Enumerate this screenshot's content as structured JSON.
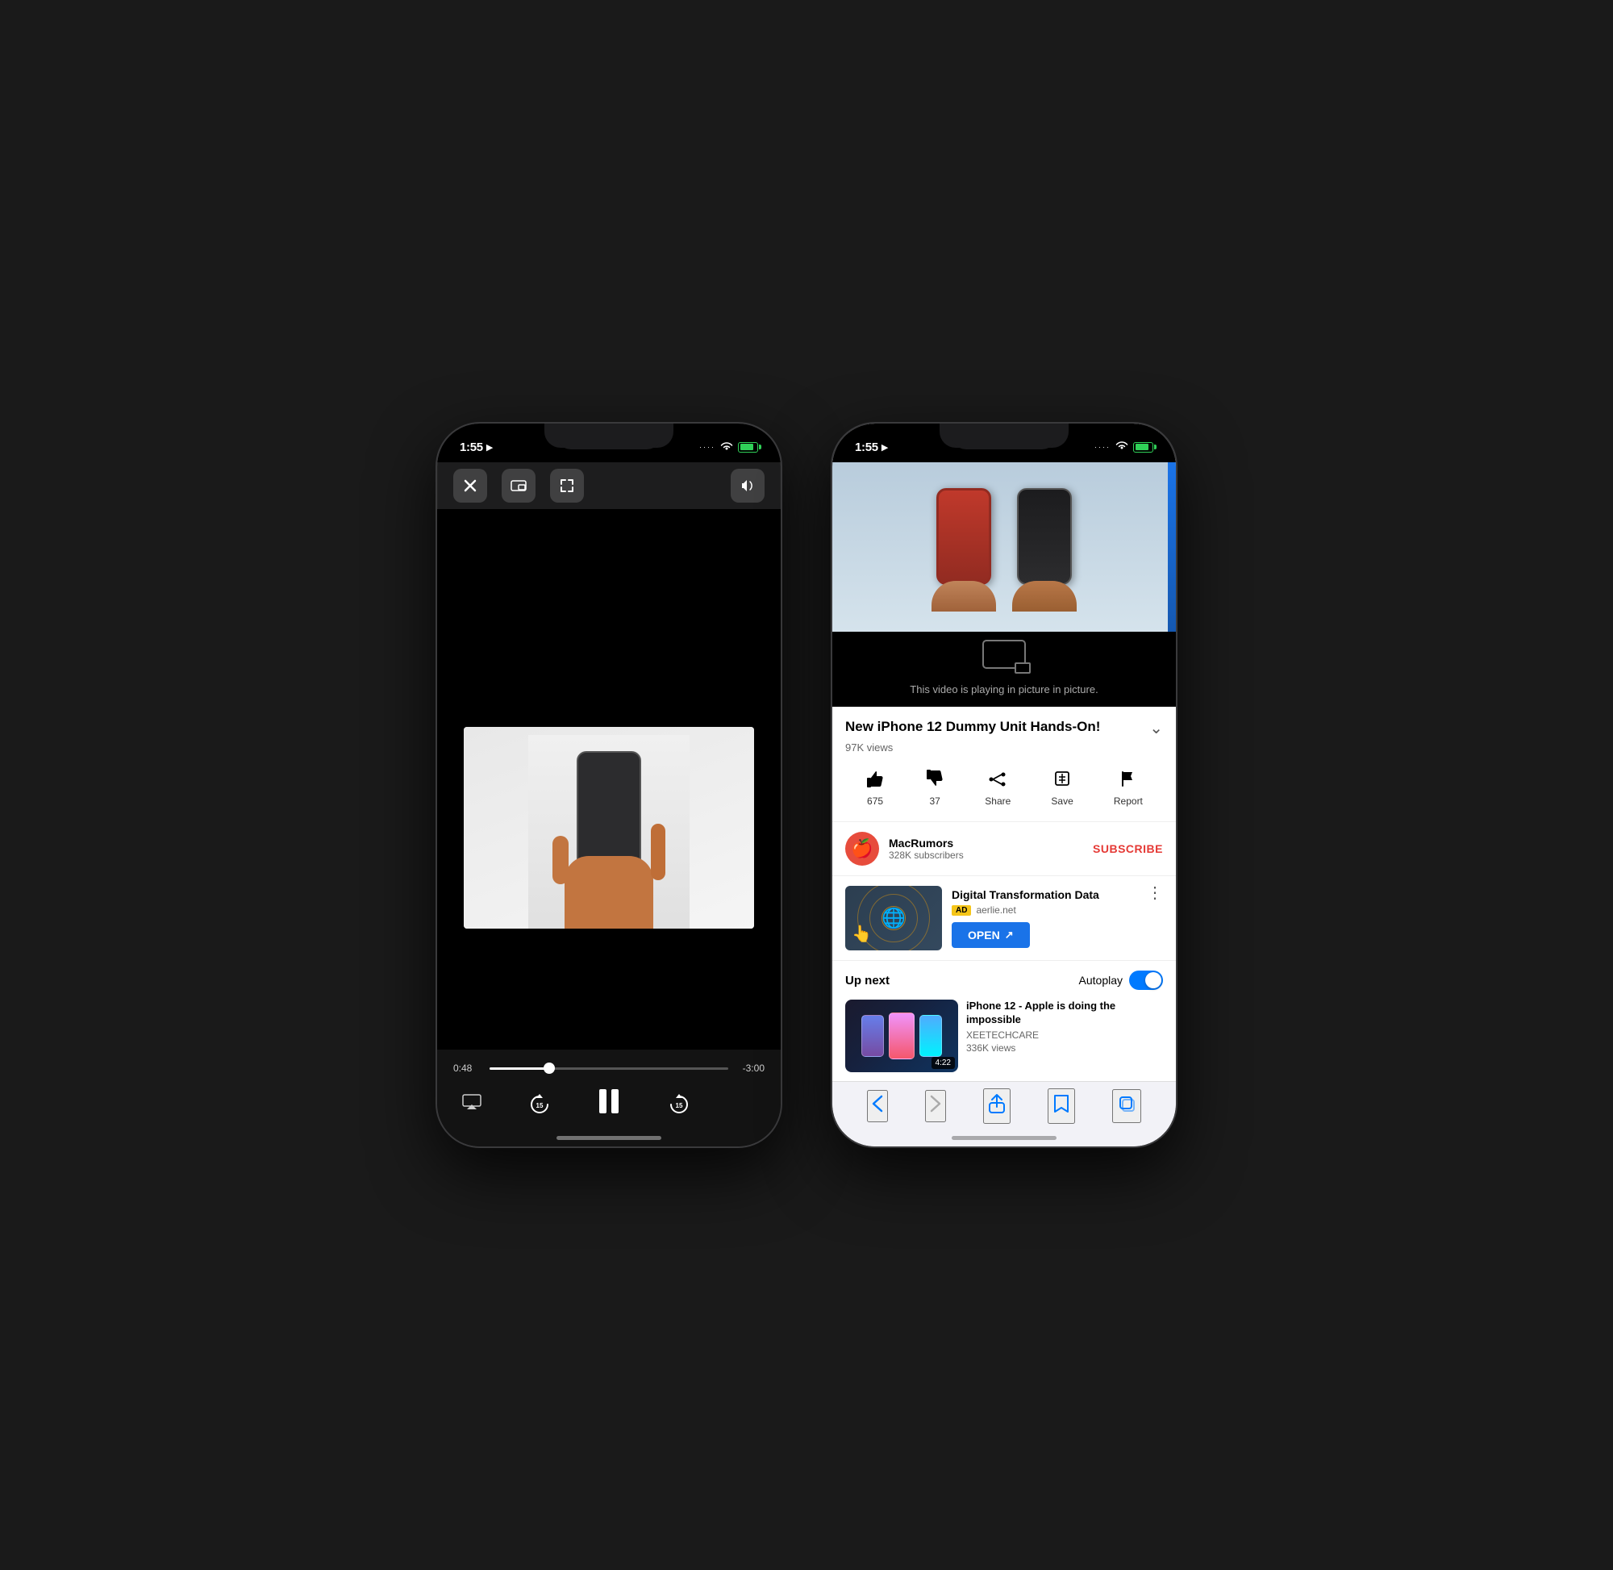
{
  "left_phone": {
    "status": {
      "time": "1:55",
      "location_icon": "▶",
      "signal_dots": "····",
      "wifi": "wifi",
      "battery_percent": 80
    },
    "player": {
      "close_label": "×",
      "pip_label": "⊡",
      "expand_label": "⤢",
      "volume_label": "🔈",
      "time_current": "0:48",
      "time_remaining": "-3:00",
      "skip_back_seconds": "15",
      "skip_fwd_seconds": "15",
      "progress_percent": 25
    }
  },
  "right_phone": {
    "status": {
      "time": "1:55",
      "location_icon": "▶"
    },
    "pip": {
      "caption": "This video is playing in picture in picture."
    },
    "video": {
      "title": "New iPhone 12 Dummy Unit Hands-On!",
      "views": "97K views",
      "likes": "675",
      "dislikes": "37",
      "share_label": "Share",
      "save_label": "Save",
      "report_label": "Report"
    },
    "channel": {
      "name": "MacRumors",
      "subscribers": "328K subscribers",
      "subscribe_label": "SUBSCRIBE",
      "avatar_emoji": "🍎"
    },
    "ad": {
      "title": "Digital Transformation Data",
      "badge": "AD",
      "domain": "aerlie.net",
      "open_label": "OPEN",
      "open_icon": "↗"
    },
    "up_next": {
      "label": "Up next",
      "autoplay_label": "Autoplay",
      "autoplay_on": true,
      "video": {
        "title": "iPhone 12 - Apple is doing the impossible",
        "channel": "XEETECHCARE",
        "views": "336K views",
        "duration": "4:22"
      }
    },
    "safari": {
      "back_label": "‹",
      "forward_label": "›",
      "share_label": "⬆",
      "bookmarks_label": "📖",
      "tabs_label": "⧉"
    }
  }
}
